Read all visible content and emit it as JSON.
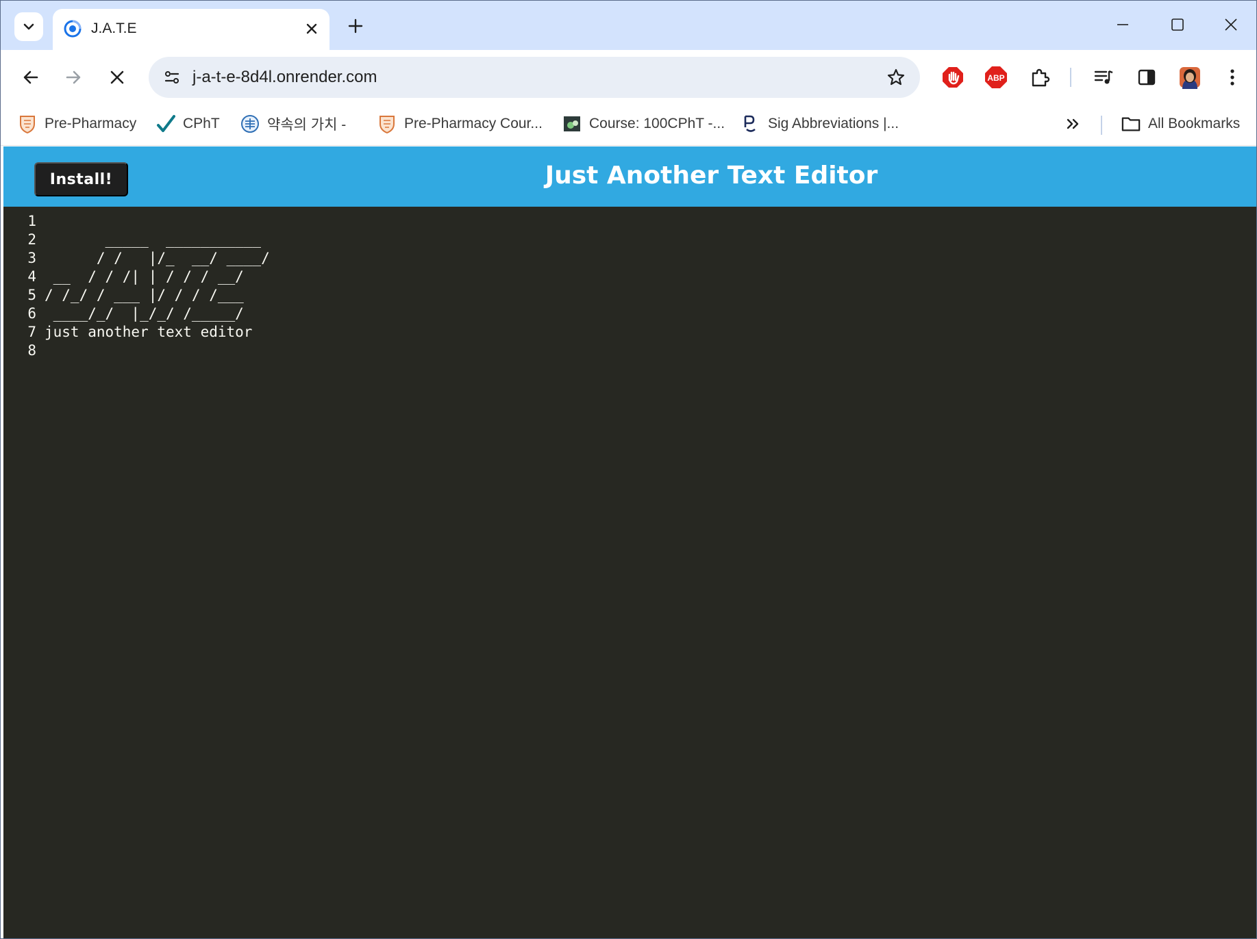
{
  "browser": {
    "tab": {
      "title": "J.A.T.E"
    },
    "address_bar": {
      "url": "j-a-t-e-8d4l.onrender.com"
    },
    "bookmarks": [
      {
        "label": "Pre-Pharmacy",
        "icon": "shield-crest-icon"
      },
      {
        "label": "CPhT",
        "icon": "checkmark-icon"
      },
      {
        "label": "약속의 가치 -",
        "icon": "pharmacy-emblem-icon"
      },
      {
        "label": "Pre-Pharmacy Cour...",
        "icon": "shield-crest-icon"
      },
      {
        "label": "Course: 100CPhT -...",
        "icon": "course-icon"
      },
      {
        "label": "Sig Abbreviations |...",
        "icon": "rx-icon"
      }
    ],
    "all_bookmarks_label": "All Bookmarks"
  },
  "app": {
    "install_label": "Install!",
    "title": "Just Another Text Editor"
  },
  "editor": {
    "line_numbers": [
      "1",
      "2",
      "3",
      "4",
      "5",
      "6",
      "7",
      "8"
    ],
    "lines": [
      "",
      "       _____  ___________",
      "      / /   |/_  __/ ____/",
      " __  / / /| | / / / __/",
      "/ /_/ / ___ |/ / / /___",
      " ____/_/  |_/_/ /_____/",
      "just another text editor",
      ""
    ]
  },
  "colors": {
    "header_bg": "#31a9e1",
    "editor_bg": "#272822",
    "editor_text": "#f8f8f2",
    "install_bg": "#1f1f1f",
    "tabstrip_bg": "#d3e3fd",
    "omnibox_bg": "#e9eef6"
  }
}
